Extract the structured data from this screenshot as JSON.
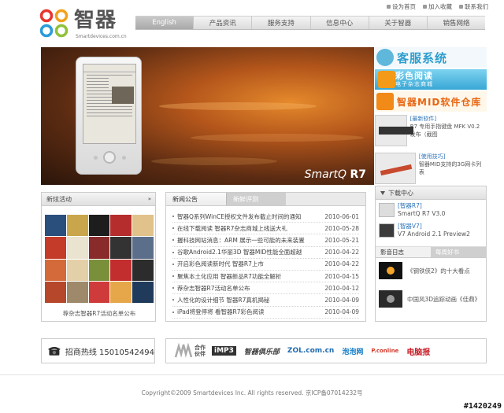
{
  "header": {
    "logo_cn": "智器",
    "logo_en": "Smartdevices.com.cn",
    "top_links": [
      "设为首页",
      "加入收藏",
      "联系我们"
    ],
    "nav": [
      "English",
      "产品资讯",
      "服务支持",
      "信息中心",
      "关于智器",
      "销售网络"
    ]
  },
  "banner": {
    "brand": "SmartQ",
    "model": "R7"
  },
  "promo": {
    "customer_service": "客服系统",
    "color_read": "彩色阅读",
    "color_read_sub": "电子杂志商城",
    "mid_store": "智器MID软件仓库",
    "soft_items": [
      {
        "tag": "[最新软件]",
        "text": "R7 专用手指键盘 MFK V0.2 发布（截图"
      },
      {
        "tag": "[使用技巧]",
        "text": "智器MID支持的3G网卡列表"
      }
    ]
  },
  "activity": {
    "title": "新炫活动",
    "more": "»",
    "caption": "荐杂志智器R7活动名单公布"
  },
  "news": {
    "tabs": [
      "新闻公告",
      "新鲜评测"
    ],
    "items": [
      {
        "title": "智器Q系列WinCE授权文件发布截止时间的通知",
        "date": "2010-06-01"
      },
      {
        "title": "在线下载阅读 智器R7杂志商城上线送大礼",
        "date": "2010-05-28"
      },
      {
        "title": "握科技网站消息：ARM 展示一些可能的未来装置",
        "date": "2010-05-21"
      },
      {
        "title": "谷歌Android2.1华丽3D 智器MID性能全面超越",
        "date": "2010-04-22"
      },
      {
        "title": "开启彩色阅读新时代 智器R7上市",
        "date": "2010-04-22"
      },
      {
        "title": "聚焦本土化应用 智器新品R7功能全解析",
        "date": "2010-04-15"
      },
      {
        "title": "荐杂志智器R7活动名单公布",
        "date": "2010-04-12"
      },
      {
        "title": "人性化的设计细节 智器R7真机揭秘",
        "date": "2010-04-09"
      },
      {
        "title": "iPad将登停将 看智器R7彩色阅读",
        "date": "2010-04-09"
      }
    ]
  },
  "download": {
    "title": "下载中心",
    "items": [
      {
        "tag": "[智器R7]",
        "text": "SmartQ R7 V3.0"
      },
      {
        "tag": "[智器V7]",
        "text": "V7 Android 2.1 Preview2"
      }
    ],
    "tabs": [
      "影音日志",
      "每周好书"
    ],
    "films": [
      "《钢铁侠2》的十大看点",
      "中国风3D追踪动画《佳鼎》"
    ]
  },
  "hotline": {
    "text": "招商热线 15010542494"
  },
  "partners": {
    "label": "合作伙伴",
    "logos": [
      "iMP3",
      "智器俱乐部",
      "ZOL.com.cn",
      "泡泡网",
      "P.conline",
      "电脑报"
    ]
  },
  "footer": {
    "copyright": "Copyright©2009 Smartdevices Inc.  All rights reserved.   京ICP备07014232号"
  },
  "watermark": "#1420249",
  "colors": {
    "accent_blue": "#2e9ecf",
    "accent_orange": "#e86511",
    "link_blue": "#2e73b8"
  }
}
